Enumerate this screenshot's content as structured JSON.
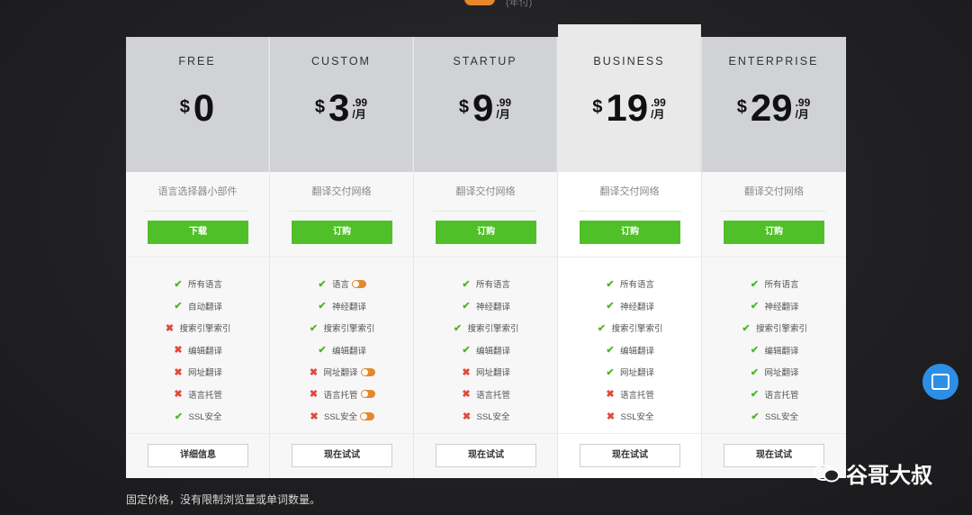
{
  "top_caption": "(年付)",
  "plans": [
    {
      "name": "FREE",
      "currency": "$",
      "amount": "0",
      "cents": "",
      "period": "",
      "description": "语言选择器小部件",
      "cta": "下载",
      "trial": "详细信息",
      "features": [
        {
          "label": "所有语言",
          "ok": true,
          "toggle": false
        },
        {
          "label": "自动翻译",
          "ok": true,
          "toggle": false
        },
        {
          "label": "搜索引擎索引",
          "ok": false,
          "toggle": false
        },
        {
          "label": "编辑翻译",
          "ok": false,
          "toggle": false
        },
        {
          "label": "网址翻译",
          "ok": false,
          "toggle": false
        },
        {
          "label": "语言托管",
          "ok": false,
          "toggle": false
        },
        {
          "label": "SSL安全",
          "ok": true,
          "toggle": false
        }
      ]
    },
    {
      "name": "CUSTOM",
      "currency": "$",
      "amount": "3",
      "cents": ".99",
      "period": "/月",
      "description": "翻译交付网络",
      "cta": "订购",
      "trial": "现在试试",
      "features": [
        {
          "label": "语言",
          "ok": true,
          "toggle": true
        },
        {
          "label": "神经翻译",
          "ok": true,
          "toggle": false
        },
        {
          "label": "搜索引擎索引",
          "ok": true,
          "toggle": false
        },
        {
          "label": "编辑翻译",
          "ok": true,
          "toggle": false
        },
        {
          "label": "网址翻译",
          "ok": false,
          "toggle": true
        },
        {
          "label": "语言托管",
          "ok": false,
          "toggle": true
        },
        {
          "label": "SSL安全",
          "ok": false,
          "toggle": true
        }
      ]
    },
    {
      "name": "STARTUP",
      "currency": "$",
      "amount": "9",
      "cents": ".99",
      "period": "/月",
      "description": "翻译交付网络",
      "cta": "订购",
      "trial": "现在试试",
      "features": [
        {
          "label": "所有语言",
          "ok": true,
          "toggle": false
        },
        {
          "label": "神经翻译",
          "ok": true,
          "toggle": false
        },
        {
          "label": "搜索引擎索引",
          "ok": true,
          "toggle": false
        },
        {
          "label": "编辑翻译",
          "ok": true,
          "toggle": false
        },
        {
          "label": "网址翻译",
          "ok": false,
          "toggle": false
        },
        {
          "label": "语言托管",
          "ok": false,
          "toggle": false
        },
        {
          "label": "SSL安全",
          "ok": false,
          "toggle": false
        }
      ]
    },
    {
      "name": "BUSINESS",
      "currency": "$",
      "amount": "19",
      "cents": ".99",
      "period": "/月",
      "description": "翻译交付网络",
      "cta": "订购",
      "trial": "现在试试",
      "featured": true,
      "features": [
        {
          "label": "所有语言",
          "ok": true,
          "toggle": false
        },
        {
          "label": "神经翻译",
          "ok": true,
          "toggle": false
        },
        {
          "label": "搜索引擎索引",
          "ok": true,
          "toggle": false
        },
        {
          "label": "编辑翻译",
          "ok": true,
          "toggle": false
        },
        {
          "label": "网址翻译",
          "ok": true,
          "toggle": false
        },
        {
          "label": "语言托管",
          "ok": false,
          "toggle": false
        },
        {
          "label": "SSL安全",
          "ok": false,
          "toggle": false
        }
      ]
    },
    {
      "name": "ENTERPRISE",
      "currency": "$",
      "amount": "29",
      "cents": ".99",
      "period": "/月",
      "description": "翻译交付网络",
      "cta": "订购",
      "trial": "现在试试",
      "features": [
        {
          "label": "所有语言",
          "ok": true,
          "toggle": false
        },
        {
          "label": "神经翻译",
          "ok": true,
          "toggle": false
        },
        {
          "label": "搜索引擎索引",
          "ok": true,
          "toggle": false
        },
        {
          "label": "编辑翻译",
          "ok": true,
          "toggle": false
        },
        {
          "label": "网址翻译",
          "ok": true,
          "toggle": false
        },
        {
          "label": "语言托管",
          "ok": true,
          "toggle": false
        },
        {
          "label": "SSL安全",
          "ok": true,
          "toggle": false
        }
      ]
    }
  ],
  "footnote": "固定价格，没有限制浏览量或单词数量。",
  "watermark": "谷哥大叔",
  "colors": {
    "accent_green": "#4fc028",
    "toggle_orange": "#e28a2b",
    "check": "#4fb82a",
    "cross": "#e04a3a",
    "chat_blue": "#2d8ee6"
  },
  "icons": {
    "yes": "check-icon",
    "no": "cross-icon",
    "chat": "chat-icon"
  }
}
